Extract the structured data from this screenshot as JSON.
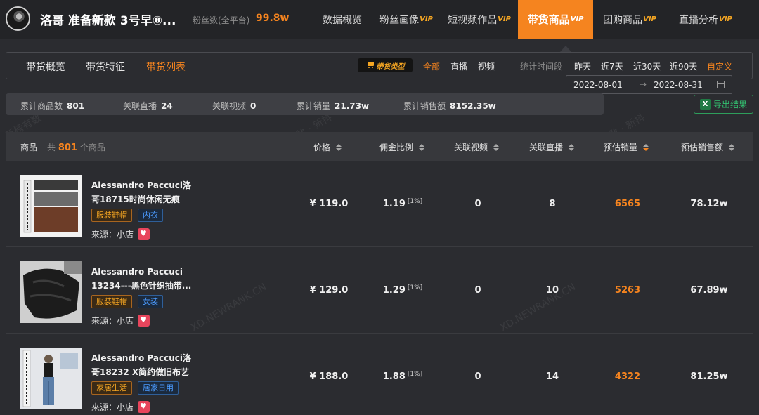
{
  "header": {
    "account_name": "洛哥 准备新款 3号早⑧...",
    "fans_label": "粉丝数(全平台)",
    "fans_value": "99.8w",
    "nav": [
      {
        "label": "数据概览",
        "vip": ""
      },
      {
        "label": "粉丝画像",
        "vip": "VIP"
      },
      {
        "label": "短视频作品",
        "vip": "VIP"
      },
      {
        "label": "带货商品",
        "vip": "VIP"
      },
      {
        "label": "团购商品",
        "vip": "VIP"
      },
      {
        "label": "直播分析",
        "vip": "VIP"
      }
    ],
    "active_nav": "带货商品"
  },
  "subnav": {
    "tabs": [
      "带货概览",
      "带货特征",
      "带货列表"
    ],
    "active_tab": "带货列表",
    "type_badge": "带货类型",
    "filters": [
      "全部",
      "直播",
      "视频"
    ],
    "active_filter": "全部",
    "period_label": "统计时间段",
    "ranges": [
      "昨天",
      "近7天",
      "近30天",
      "近90天",
      "自定义"
    ],
    "active_range": "自定义"
  },
  "datepicker": {
    "start": "2022-08-01",
    "separator": "→",
    "end": "2022-08-31"
  },
  "stats": [
    {
      "label": "累计商品数",
      "value": "801"
    },
    {
      "label": "关联直播",
      "value": "24"
    },
    {
      "label": "关联视频",
      "value": "0"
    },
    {
      "label": "累计销量",
      "value": "21.73w"
    },
    {
      "label": "累计销售额",
      "value": "8152.35w"
    }
  ],
  "export_label": "导出结果",
  "export_icon_text": "X",
  "table": {
    "product_header": "商品",
    "count_prefix": "共",
    "count": "801",
    "count_suffix": "个商品",
    "columns": [
      "价格",
      "佣金比例",
      "关联视频",
      "关联直播",
      "预估销量",
      "预估销售额"
    ],
    "rows": [
      {
        "title": "Alessandro Paccuci洛哥18715时尚休闲无痕塑...",
        "tags": [
          "服装鞋帽",
          "内衣"
        ],
        "source": "来源：小店",
        "price": "¥ 119.0",
        "commission": "1.19",
        "commission_note": "[1%]",
        "videos": "0",
        "lives": "8",
        "sales": "6565",
        "revenue": "78.12w"
      },
      {
        "title": "Alessandro Paccuci 13234---黑色针织抽带...",
        "tags": [
          "服装鞋帽",
          "女装"
        ],
        "source": "来源：小店",
        "price": "¥ 129.0",
        "commission": "1.29",
        "commission_note": "[1%]",
        "videos": "0",
        "lives": "10",
        "sales": "5263",
        "revenue": "67.89w"
      },
      {
        "title": "Alessandro Paccuci洛哥18232 X简约做旧布艺面...",
        "tags": [
          "家居生活",
          "居家日用"
        ],
        "source": "来源：小店",
        "price": "¥ 188.0",
        "commission": "1.88",
        "commission_note": "[1%]",
        "videos": "0",
        "lives": "14",
        "sales": "4322",
        "revenue": "81.25w"
      }
    ]
  },
  "watermarks": [
    "新榜有数 · 新抖",
    "新榜有数 · 新抖",
    "XD.NEWRANK.CN",
    "XD.NEWRANK.CN",
    "新榜有数 · 新抖"
  ],
  "colors": {
    "accent": "#f5841f",
    "vip": "#f5a623",
    "export": "#33c070",
    "tag_blue": "#4b9bff"
  }
}
